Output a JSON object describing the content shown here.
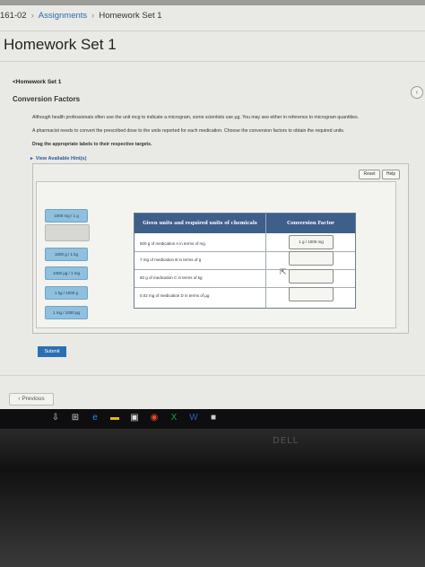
{
  "breadcrumb": {
    "course": "161-02",
    "assignments": "Assignments",
    "current": "Homework Set 1"
  },
  "page": {
    "title": "Homework Set 1",
    "back_link": "<Homework Set 1",
    "section_title": "Conversion Factors"
  },
  "instructions": {
    "p1": "Although health professionals often use the unit mcg to indicate a microgram, some scientists use µg. You may see either in reference to microgram quantities.",
    "p2": "A pharmacist needs to convert the prescribed dose to the units reported for each medication. Choose the conversion factors to obtain the required units.",
    "p3": "Drag the appropriate labels to their respective targets.",
    "hints": "View Available Hint(s)"
  },
  "buttons": {
    "reset": "Reset",
    "help": "Help",
    "submit": "Submit",
    "previous": "Previous"
  },
  "labels": {
    "chip1": "1000 mg / 1 g",
    "chip2": "1000 g / 1 kg",
    "chip3": "1000 µg / 1 mg",
    "chip4": "1 kg / 1000 g",
    "chip5": "1 mg / 1000 µg"
  },
  "table": {
    "header_given": "Given units and required units of chemicals",
    "header_factor": "Conversion Factor",
    "rows": [
      "500 g of medication A in terms of mg",
      "7 mg of medication B in terms of g",
      "60 g of medication C in terms of kg",
      "0.02 mg of medication D in terms of µg"
    ],
    "placed": "1 g / 1000 mg"
  },
  "colors": {
    "chip_fill": "#8fc0de",
    "header_fill": "#3d5f8a",
    "submit_fill": "#2a6fb3"
  },
  "icons": {
    "hints": "triangle-right-icon",
    "back": "chevron-left-icon",
    "previous": "chevron-left-icon"
  }
}
